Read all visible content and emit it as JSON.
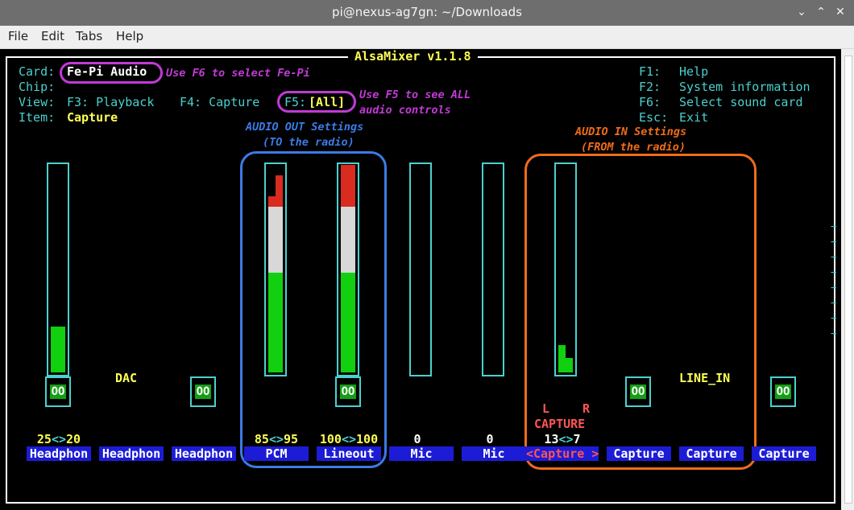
{
  "window": {
    "title": "pi@nexus-ag7gn: ~/Downloads",
    "controls": {
      "minimize": "⌄",
      "maximize": "⌃",
      "close": "✕"
    }
  },
  "menu": [
    "File",
    "Edit",
    "Tabs",
    "Help"
  ],
  "app": {
    "title": "AlsaMixer v1.1.8",
    "card_label": "Card:",
    "card_value": "Fe-Pi Audio",
    "chip_label": "Chip:",
    "view_label": "View:",
    "view_playback": "F3: Playback",
    "view_capture": "F4: Capture",
    "view_all_key": "F5:",
    "view_all_value": "[All]",
    "item_label": "Item:",
    "item_value": "Capture",
    "help": [
      {
        "key": "F1:",
        "text": "Help"
      },
      {
        "key": "F2:",
        "text": "System information"
      },
      {
        "key": "F6:",
        "text": "Select sound card"
      },
      {
        "key": "Esc:",
        "text": "Exit"
      }
    ]
  },
  "annotations": {
    "card_note": "Use F6 to select Fe-Pi",
    "f5_note_1": "Use F5 to see ALL",
    "f5_note_2": "audio controls",
    "out_title_1": "AUDIO OUT Settings",
    "out_title_2": "(TO the radio)",
    "in_title_1": "AUDIO IN Settings",
    "in_title_2": "(FROM the radio)",
    "colors": {
      "card": "#c23ad6",
      "out": "#3b7be6",
      "in": "#ef6c1a"
    }
  },
  "channel_text": {
    "dac": "DAC",
    "line_in": "LINE_IN",
    "capture_l": "L",
    "capture_r": "R",
    "capture_word": "CAPTURE",
    "mute_glyph": "OO",
    "arrow": "→"
  },
  "channels": [
    {
      "label": "Headphon",
      "volume_left": "25",
      "sep": "<>",
      "volume_right": "20",
      "level_left": 0.22,
      "level_right": 0.22
    },
    {
      "label": "Headphon",
      "volume_left": "",
      "sep": "",
      "volume_right": ""
    },
    {
      "label": "Headphon",
      "volume_left": "",
      "sep": "",
      "volume_right": ""
    },
    {
      "label": "PCM",
      "volume_left": "85",
      "sep": "<>",
      "volume_right": "95",
      "level_left": 0.85,
      "level_right": 0.95
    },
    {
      "label": "Lineout",
      "volume_left": "100",
      "sep": "<>",
      "volume_right": "100",
      "level_left": 1.0,
      "level_right": 1.0
    },
    {
      "label": "Mic",
      "volume": "0"
    },
    {
      "label": "Mic",
      "volume": "0"
    },
    {
      "label": "<Capture >",
      "volume_left": "13",
      "sep": "<>",
      "volume_right": "7",
      "level_left": 0.13,
      "level_right": 0.07
    },
    {
      "label": "Capture",
      "volume": ""
    },
    {
      "label": "Capture",
      "volume": ""
    },
    {
      "label": "Capture",
      "volume": ""
    }
  ]
}
